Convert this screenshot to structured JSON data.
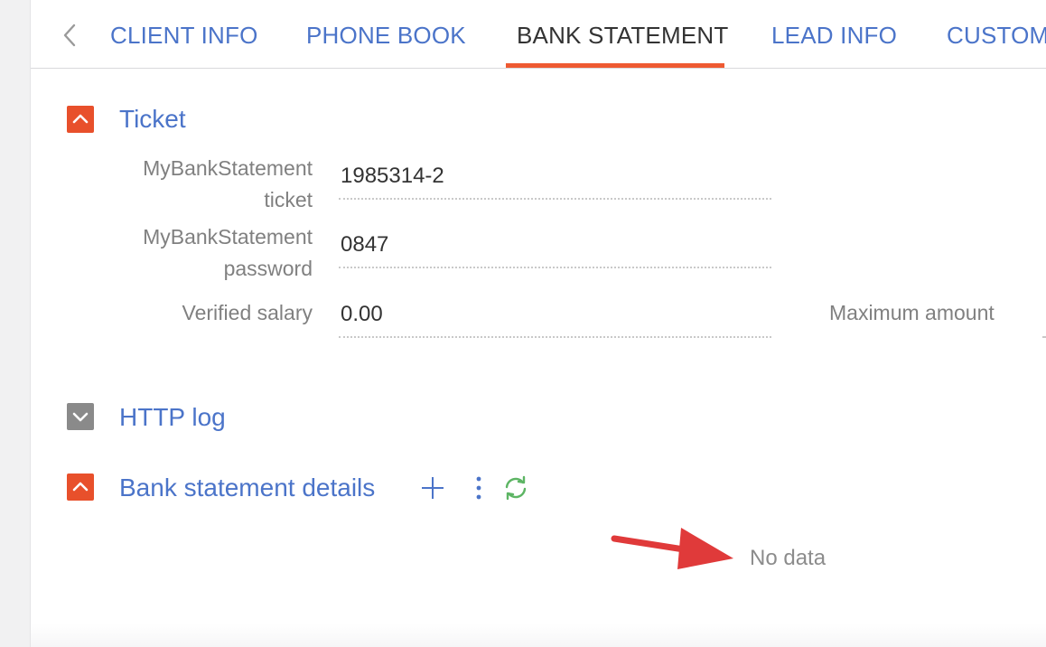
{
  "tabs": {
    "back_icon": "chevron-left-icon",
    "items": [
      {
        "label": "CLIENT INFO"
      },
      {
        "label": "PHONE BOOK"
      },
      {
        "label": "BANK STATEMENT"
      },
      {
        "label": "LEAD INFO"
      },
      {
        "label": "CUSTOMI"
      }
    ],
    "active": "BANK STATEMENT",
    "accent_color": "#ee5a32",
    "link_color": "#4b74c9"
  },
  "ticket_section": {
    "title": "Ticket",
    "expanded": true,
    "toggle_icon": "chevron-up-icon",
    "fields": {
      "ticket": {
        "label_line1": "MyBankStatement",
        "label_line2": "ticket",
        "value": "1985314-2"
      },
      "password": {
        "label_line1": "MyBankStatement",
        "label_line2": "password",
        "value": "0847"
      },
      "salary": {
        "label": "Verified salary",
        "value": "0.00"
      },
      "max_amount": {
        "label": "Maximum amount"
      }
    }
  },
  "http_log_section": {
    "title": "HTTP log",
    "expanded": false,
    "toggle_icon": "chevron-down-icon"
  },
  "bank_details_section": {
    "title": "Bank statement details",
    "expanded": true,
    "toggle_icon": "chevron-up-icon",
    "actions": [
      "plus-icon",
      "more-vertical-icon",
      "refresh-icon"
    ],
    "empty_text": "No data"
  },
  "annotation": {
    "type": "arrow",
    "color": "#e03a3a"
  }
}
